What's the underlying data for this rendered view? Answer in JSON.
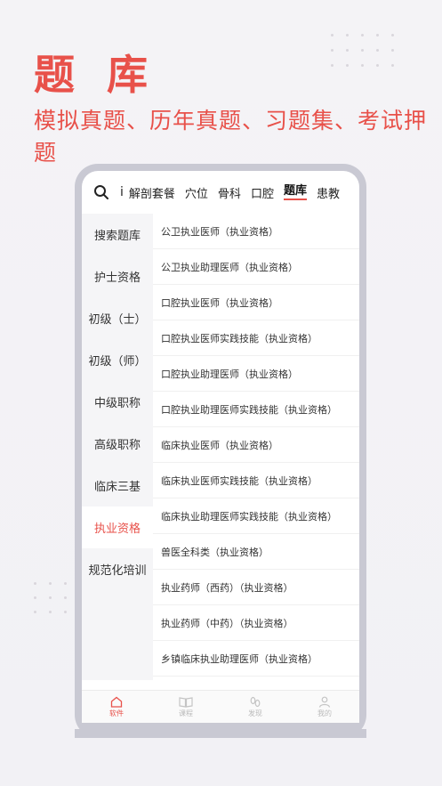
{
  "promo": {
    "title": "题 库",
    "subtitle": "模拟真题、历年真题、习题集、考试押题"
  },
  "colors": {
    "accent": "#e8514a",
    "phone_frame": "#c9c9d3"
  },
  "topbar": {
    "search_icon": "search-icon",
    "tabs": [
      "i",
      "解剖套餐",
      "穴位",
      "骨科",
      "口腔",
      "题库",
      "患教"
    ],
    "active_tab": "题库"
  },
  "sidebar": {
    "items": [
      "搜索题库",
      "护士资格",
      "初级（士）",
      "初级（师）",
      "中级职称",
      "高级职称",
      "临床三基",
      "执业资格",
      "规范化培训"
    ],
    "active": "执业资格"
  },
  "list": {
    "items": [
      "公卫执业医师（执业资格）",
      "公卫执业助理医师（执业资格）",
      "口腔执业医师（执业资格）",
      "口腔执业医师实践技能（执业资格）",
      "口腔执业助理医师（执业资格）",
      "口腔执业助理医师实践技能（执业资格）",
      "临床执业医师（执业资格）",
      "临床执业医师实践技能（执业资格）",
      "临床执业助理医师实践技能（执业资格）",
      "兽医全科类（执业资格）",
      "执业药师（西药）（执业资格）",
      "执业药师（中药）（执业资格）",
      "乡镇临床执业助理医师（执业资格）"
    ]
  },
  "tabbar": {
    "items": [
      {
        "label": "软件",
        "icon": "home-icon"
      },
      {
        "label": "课程",
        "icon": "book-icon"
      },
      {
        "label": "发现",
        "icon": "footprint-icon"
      },
      {
        "label": "我的",
        "icon": "person-icon"
      }
    ],
    "active": "软件"
  }
}
